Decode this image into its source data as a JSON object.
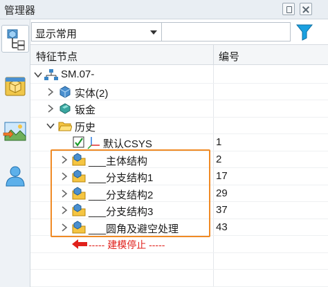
{
  "window": {
    "title": "管理器"
  },
  "filter": {
    "selected": "显示常用",
    "search_value": ""
  },
  "tree": {
    "col_feature": "特征节点",
    "col_number": "编号",
    "root": {
      "label": "SM.07-"
    },
    "nodes": [
      {
        "label": "实体(2)",
        "number": ""
      },
      {
        "label": "钣金",
        "number": ""
      },
      {
        "label": "历史",
        "number": ""
      },
      {
        "label": "默认CSYS",
        "number": "1"
      },
      {
        "label": "___主体结构",
        "number": "2"
      },
      {
        "label": "___分支结构1",
        "number": "17"
      },
      {
        "label": "___分支结构2",
        "number": "29"
      },
      {
        "label": "___分支结构3",
        "number": "37"
      },
      {
        "label": "___圆角及避空处理",
        "number": "43"
      }
    ],
    "stop_marker": "----- 建模停止 -----"
  },
  "colors": {
    "highlight": "#f08a24",
    "stop": "#e0201b",
    "filter_icon": "#1aa0e0"
  }
}
